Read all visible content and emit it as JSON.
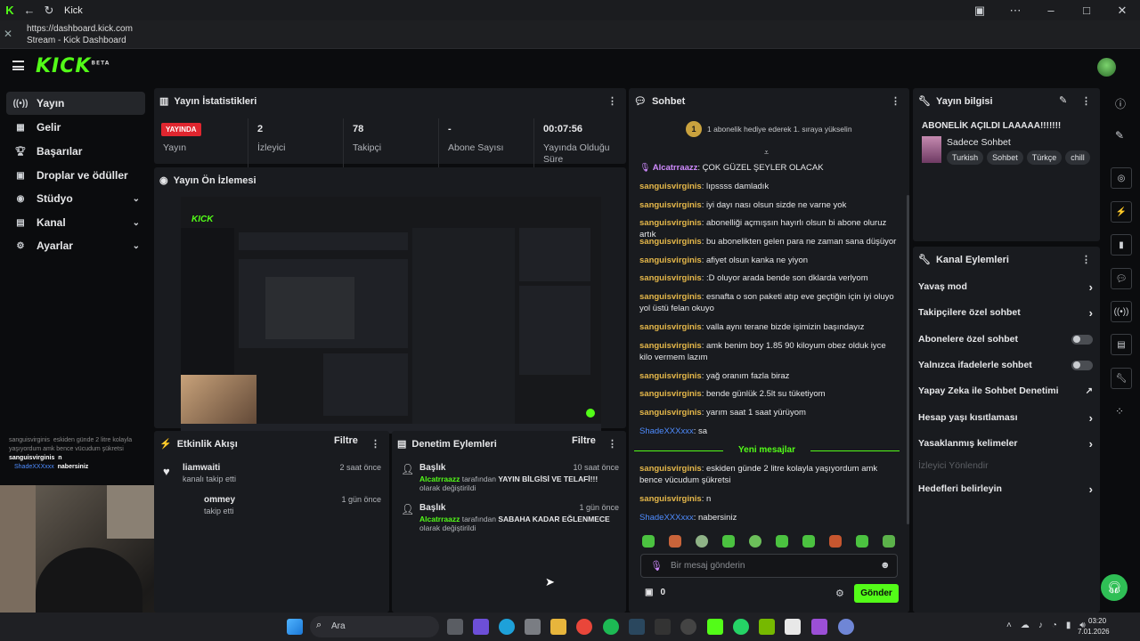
{
  "browser": {
    "tab_title": "Kick",
    "url": "https://dashboard.kick.com",
    "page_title": "Stream - Kick Dashboard"
  },
  "brand": {
    "logo": "KICK",
    "sup": "BETA",
    "accent": "#53fc18"
  },
  "sidebar": {
    "items": [
      {
        "label": "Yayın",
        "icon": "broadcast-icon"
      },
      {
        "label": "Gelir",
        "icon": "revenue-icon"
      },
      {
        "label": "Başarılar",
        "icon": "trophy-icon"
      },
      {
        "label": "Droplar ve ödüller",
        "icon": "gift-icon"
      },
      {
        "label": "Stüdyo",
        "icon": "studio-icon"
      },
      {
        "label": "Kanal",
        "icon": "channel-icon"
      },
      {
        "label": "Ayarlar",
        "icon": "gear-icon"
      }
    ]
  },
  "stats": {
    "title": "Yayın İstatistikleri",
    "live_badge": "YAYINDA",
    "live_label": "Yayın",
    "items": [
      {
        "value": "2",
        "label": "İzleyici"
      },
      {
        "value": "78",
        "label": "Takipçi"
      },
      {
        "value": "-",
        "label": "Abone Sayısı"
      },
      {
        "value": "00:07:56",
        "label": "Yayında Olduğu Süre"
      }
    ]
  },
  "preview": {
    "title": "Yayın Ön İzlemesi"
  },
  "activity": {
    "title": "Etkinlik Akışı",
    "filter": "Filtre",
    "items": [
      {
        "user": "liamwaiti",
        "text": "kanalı takip etti",
        "time": "2 saat önce"
      },
      {
        "user": "ommey",
        "text": "takip etti",
        "time": "1 gün önce"
      }
    ]
  },
  "moderation": {
    "title": "Denetim Eylemleri",
    "filter": "Filtre",
    "items": [
      {
        "heading": "Başlık",
        "user": "Alcatrraazz",
        "by": " tarafından ",
        "bold": "YAYIN BİLGİSİ VE TELAFİ!!!",
        "rest": " olarak değiştirildi",
        "time": "10 saat önce"
      },
      {
        "heading": "Başlık",
        "user": "Alcatrraazz",
        "by": " tarafından ",
        "bold": "SABAHA KADAR EĞLENMECE",
        "rest": " olarak değiştirildi",
        "time": "1 gün önce"
      }
    ]
  },
  "chat": {
    "title": "Sohbet",
    "pinned": "1 abonelik hediye ederek 1. sıraya yükselin",
    "pinned_num": "1",
    "messages": [
      {
        "user": "Alcatrraazz",
        "text": " ÇOK GÜZEL ŞEYLER OLACAK",
        "type": "mod"
      },
      {
        "user": "sanguisvirginis",
        "text": " lıpssss damladık"
      },
      {
        "user": "sanguisvirginis",
        "text": " iyi dayı nası olsun sizde ne varne yok"
      },
      {
        "user": "sanguisvirginis",
        "text": " abonelliği açmışsın hayırlı olsun bi abone oluruz artık"
      },
      {
        "user": "sanguisvirginis",
        "text": " bu abonelikten gelen para ne zaman sana düşüyor"
      },
      {
        "user": "sanguisvirginis",
        "text": " afiyet olsun kanka ne yiyon"
      },
      {
        "user": "sanguisvirginis",
        "text": " :D oluyor arada bende son dklarda verlyom"
      },
      {
        "user": "sanguisvirginis",
        "text": " esnafta o son paketi atıp eve geçtiğin için iyi oluyo yol üstü felan okuyo"
      },
      {
        "user": "sanguisvirginis",
        "text": " valla aynı terane bizde işimizin başındayız"
      },
      {
        "user": "sanguisvirginis",
        "text": " amk benim boy 1.85 90 kiloyum obez olduk iyce kilo vermem lazım"
      },
      {
        "user": "sanguisvirginis",
        "text": " yağ oranım fazla biraz"
      },
      {
        "user": "sanguisvirginis",
        "text": " bende günlük 2.5lt su tüketiyom"
      },
      {
        "user": "sanguisvirginis",
        "text": " yarım saat 1 saat yürüyom"
      },
      {
        "user": "ShadeXXXxxx",
        "text": " sa",
        "type": "blue"
      }
    ],
    "new_label": "Yeni mesajlar",
    "new_messages": [
      {
        "user": "sanguisvirginis",
        "text": " eskiden günde 2 litre kolayla yaşıyordum amk bence vücudum şükretsi"
      },
      {
        "user": "sanguisvirginis",
        "text": " n"
      },
      {
        "user": "ShadeXXXxxx",
        "text": " nabersiniz",
        "type": "blue"
      }
    ],
    "placeholder": "Bir mesaj gönderin",
    "send": "Gönder",
    "points": "0"
  },
  "stream_info": {
    "title": "Yayın bilgisi",
    "stream_title": "ABONELİK AÇILDI LAAAAA!!!!!!!",
    "category": "Sadece Sohbet",
    "tags": [
      "Turkish",
      "Sohbet",
      "Türkçe",
      "chill"
    ]
  },
  "channel_actions": {
    "title": "Kanal Eylemleri",
    "items": [
      {
        "label": "Yavaş mod",
        "kind": "chevron"
      },
      {
        "label": "Takipçilere özel sohbet",
        "kind": "chevron"
      },
      {
        "label": "Abonelere özel sohbet",
        "kind": "toggle"
      },
      {
        "label": "Yalnızca ifadelerle sohbet",
        "kind": "toggle"
      },
      {
        "label": "Yapay Zeka ile Sohbet Denetimi",
        "kind": "external"
      },
      {
        "label": "Hesap yaşı kısıtlaması",
        "kind": "chevron"
      },
      {
        "label": "Yasaklanmış kelimeler",
        "kind": "chevron"
      },
      {
        "label": "İzleyici Yönlendir",
        "kind": "disabled"
      },
      {
        "label": "Hedefleri belirleyin",
        "kind": "chevron"
      }
    ]
  },
  "overlay_chat": [
    {
      "user": "sanguisvirginis",
      "text": "eskiden günde 2 litre kolayla yaşıyordum amk bence vücudum şükretsi"
    },
    {
      "user": "sanguisvirginis",
      "text": "n"
    },
    {
      "user": "ShadeXXXxxx",
      "text": "nabersiniz"
    }
  ],
  "taskbar": {
    "search": "Ara",
    "time": "03:20",
    "date": "7.01.2026"
  }
}
